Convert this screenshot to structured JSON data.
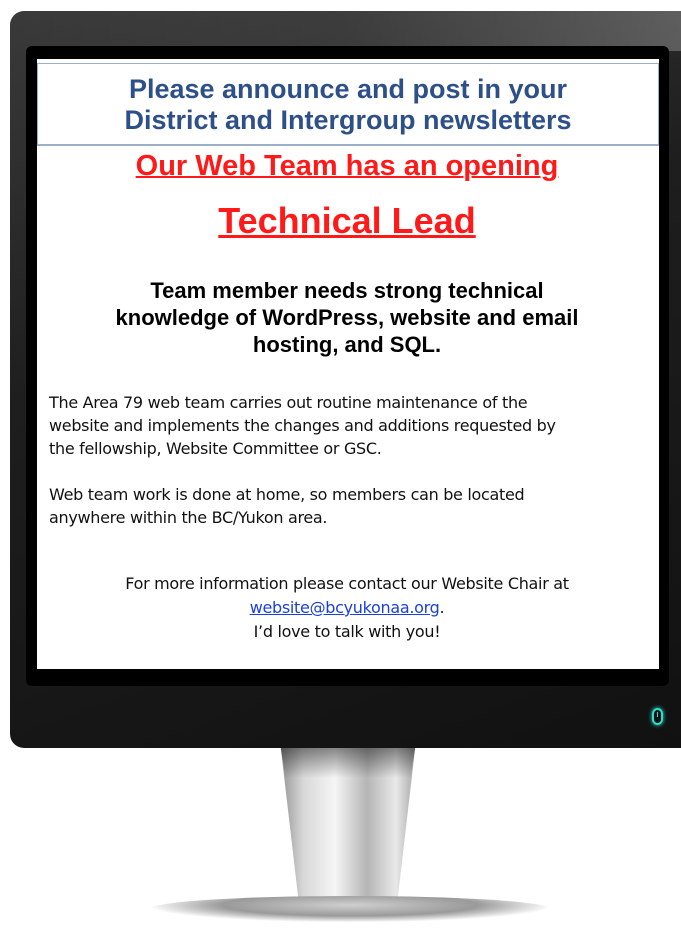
{
  "poster": {
    "banner_line1": "Please announce and post in your",
    "banner_line2": "District and Intergroup newsletters",
    "opening": "Our Web Team has an opening",
    "role": "Technical Lead",
    "requirements_line1": "Team member needs strong technical",
    "requirements_line2": "knowledge of WordPress, website and email",
    "requirements_line3": "hosting, and SQL.",
    "para1_line1": "The Area 79 web team carries out routine maintenance of the",
    "para1_line2": "website and implements the changes and additions requested by",
    "para1_line3": "the fellowship, Website Committee or GSC.",
    "para2_line1": "Web team work is done at home, so members can be located",
    "para2_line2": "anywhere within the BC/Yukon area.",
    "contact_line1": "For more information please contact our Website Chair at",
    "contact_email": "website@bcyukonaa.org",
    "contact_period": ".",
    "contact_line3": "I’d love to talk with you!"
  },
  "colors": {
    "banner_text": "#2e5089",
    "headline_red": "#ff1a1a",
    "link_blue": "#1a3fe0",
    "power_led": "#2ce0d0"
  },
  "icons": {
    "power": "mouse-power-icon"
  }
}
